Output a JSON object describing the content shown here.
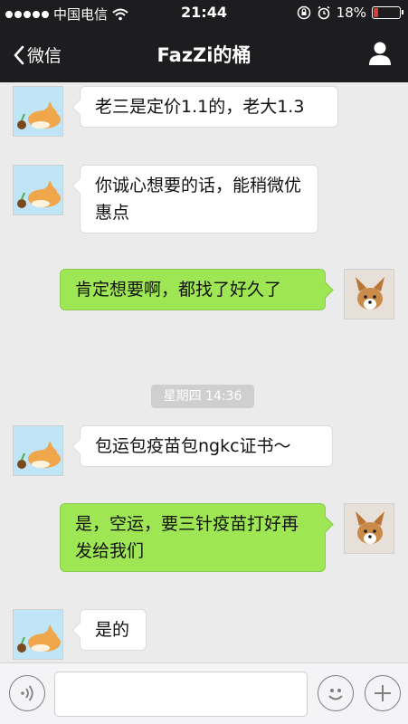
{
  "status_bar": {
    "carrier": "中国电信",
    "time": "21:44",
    "battery": "18%"
  },
  "nav": {
    "back_label": "微信",
    "title": "FazZi的桶"
  },
  "messages": [
    {
      "sender": "other",
      "text": "老三是定价1.1的，老大1.3"
    },
    {
      "sender": "other",
      "text": "你诚心想要的话，能稍微优惠点"
    },
    {
      "sender": "me",
      "text": "肯定想要啊，都找了好久了"
    },
    {
      "sender": "other",
      "text": "包运包疫苗包ngkc证书～"
    },
    {
      "sender": "me",
      "text": "是，空运，要三针疫苗打好再发给我们"
    },
    {
      "sender": "other",
      "text": "是的"
    }
  ],
  "timestamp": "星期四 14:36",
  "input": {
    "value": ""
  },
  "colors": {
    "bar_background": "#1d1d1f",
    "chat_background": "#ebebeb",
    "outgoing_bubble": "#9fe655",
    "incoming_bubble": "#ffffff",
    "battery_low": "#e53935"
  },
  "icons": {
    "voice": "voice-icon",
    "emoji": "emoji-icon",
    "more": "plus-icon",
    "back": "chevron-left-icon",
    "profile": "person-icon"
  }
}
